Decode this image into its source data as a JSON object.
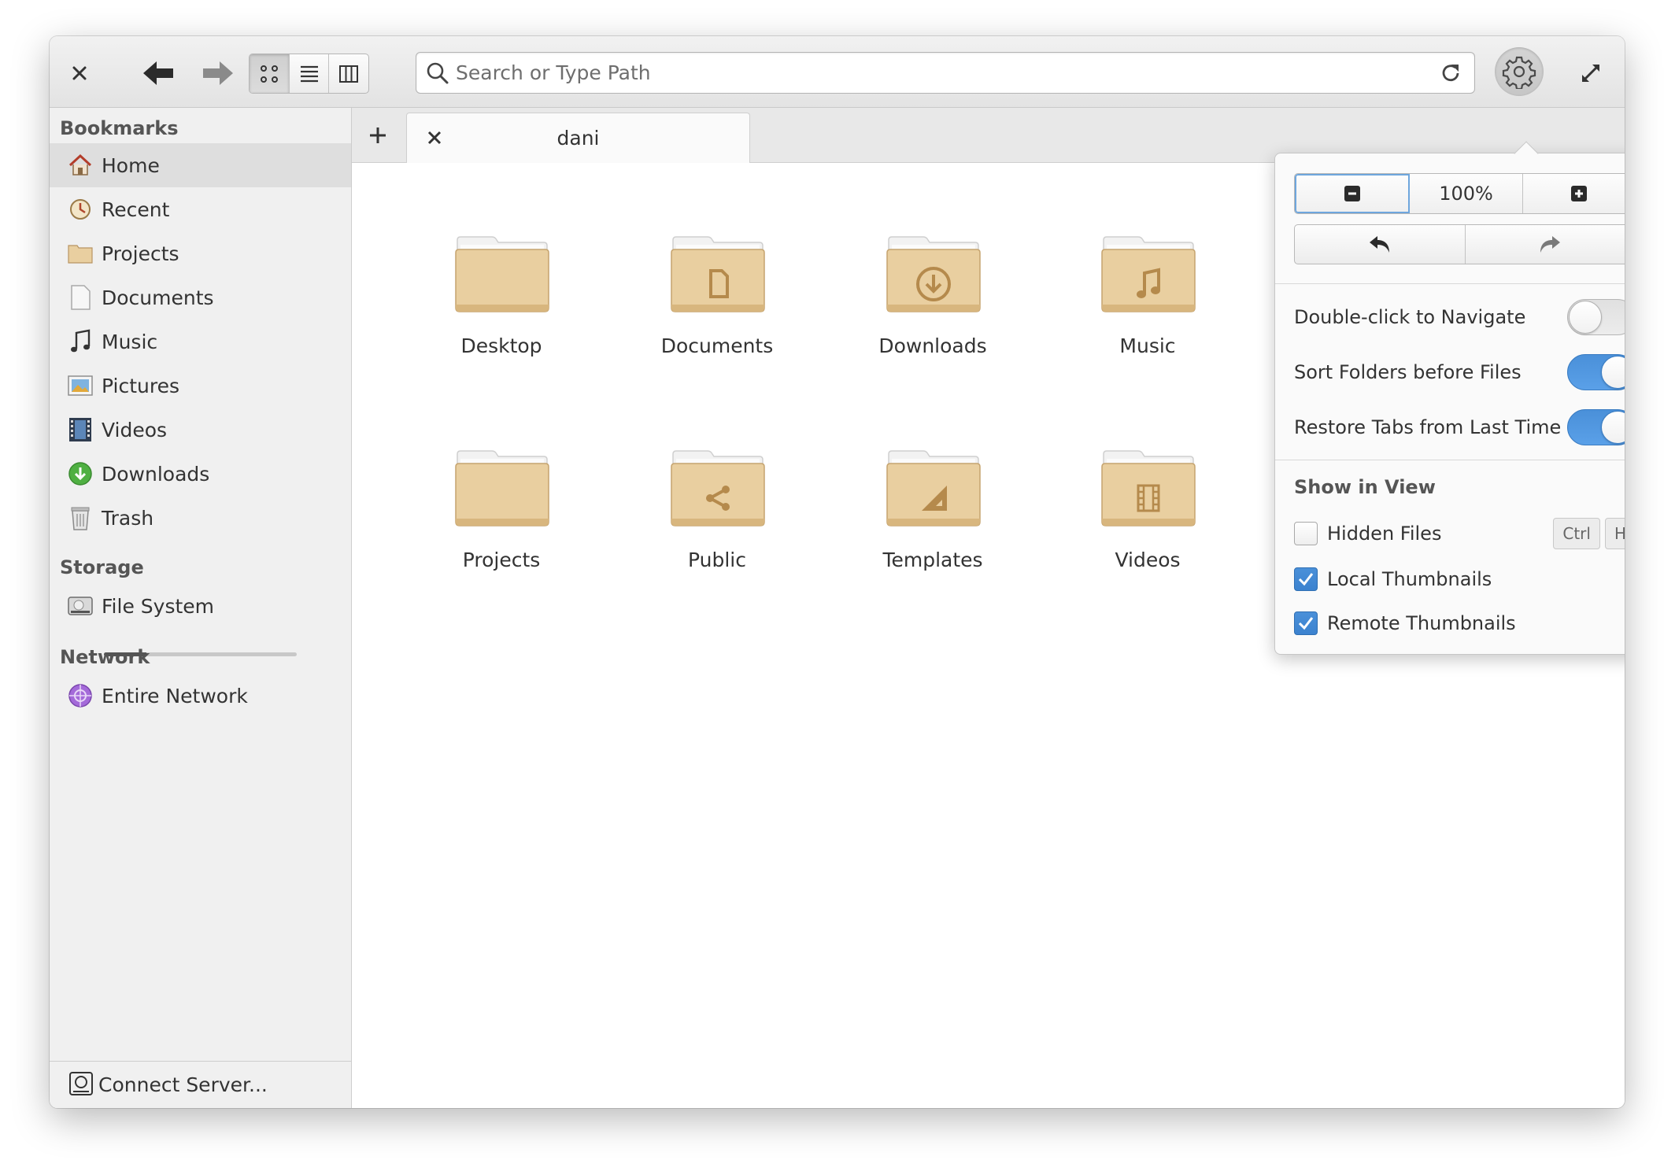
{
  "header": {
    "close_icon": "close-icon",
    "back_icon": "arrow-left-icon",
    "forward_icon": "arrow-right-icon",
    "view_modes": [
      "icon-view",
      "list-view",
      "column-view"
    ],
    "active_view": "icon-view",
    "search_placeholder": "Search or Type Path",
    "reload_icon": "reload-icon",
    "settings_icon": "gear-icon",
    "maximize_icon": "maximize-icon"
  },
  "sidebar": {
    "bookmarks_heading": "Bookmarks",
    "bookmarks": [
      {
        "label": "Home",
        "icon": "home-icon",
        "selected": true
      },
      {
        "label": "Recent",
        "icon": "recent-icon"
      },
      {
        "label": "Projects",
        "icon": "folder-icon"
      },
      {
        "label": "Documents",
        "icon": "document-icon"
      },
      {
        "label": "Music",
        "icon": "music-icon"
      },
      {
        "label": "Pictures",
        "icon": "pictures-icon"
      },
      {
        "label": "Videos",
        "icon": "videos-icon"
      },
      {
        "label": "Downloads",
        "icon": "downloads-icon"
      },
      {
        "label": "Trash",
        "icon": "trash-icon"
      }
    ],
    "storage_heading": "Storage",
    "storage": [
      {
        "label": "File System",
        "icon": "harddisk-icon",
        "usage_fraction": 0.22
      }
    ],
    "network_heading": "Network",
    "network": [
      {
        "label": "Entire Network",
        "icon": "network-icon"
      }
    ],
    "footer_label": "Connect Server..."
  },
  "tabs": [
    {
      "label": "dani"
    }
  ],
  "folders": [
    {
      "label": "Desktop",
      "emblem": "none"
    },
    {
      "label": "Documents",
      "emblem": "document"
    },
    {
      "label": "Downloads",
      "emblem": "download"
    },
    {
      "label": "Music",
      "emblem": "music"
    },
    {
      "label": "Projects",
      "emblem": "none"
    },
    {
      "label": "Public",
      "emblem": "share"
    },
    {
      "label": "Templates",
      "emblem": "template"
    },
    {
      "label": "Videos",
      "emblem": "film"
    }
  ],
  "popover": {
    "zoom_value": "100%",
    "settings": [
      {
        "label": "Double-click to Navigate",
        "on": false
      },
      {
        "label": "Sort Folders before Files",
        "on": true
      },
      {
        "label": "Restore Tabs from Last Time",
        "on": true
      }
    ],
    "show_heading": "Show in View",
    "checks": [
      {
        "label": "Hidden Files",
        "checked": false,
        "shortcut": [
          "Ctrl",
          "H"
        ]
      },
      {
        "label": "Local Thumbnails",
        "checked": true
      },
      {
        "label": "Remote Thumbnails",
        "checked": true
      }
    ]
  },
  "colors": {
    "accent": "#4a90d9",
    "folder": "#e9cfa0",
    "folder_emblem": "#b58a4c"
  }
}
